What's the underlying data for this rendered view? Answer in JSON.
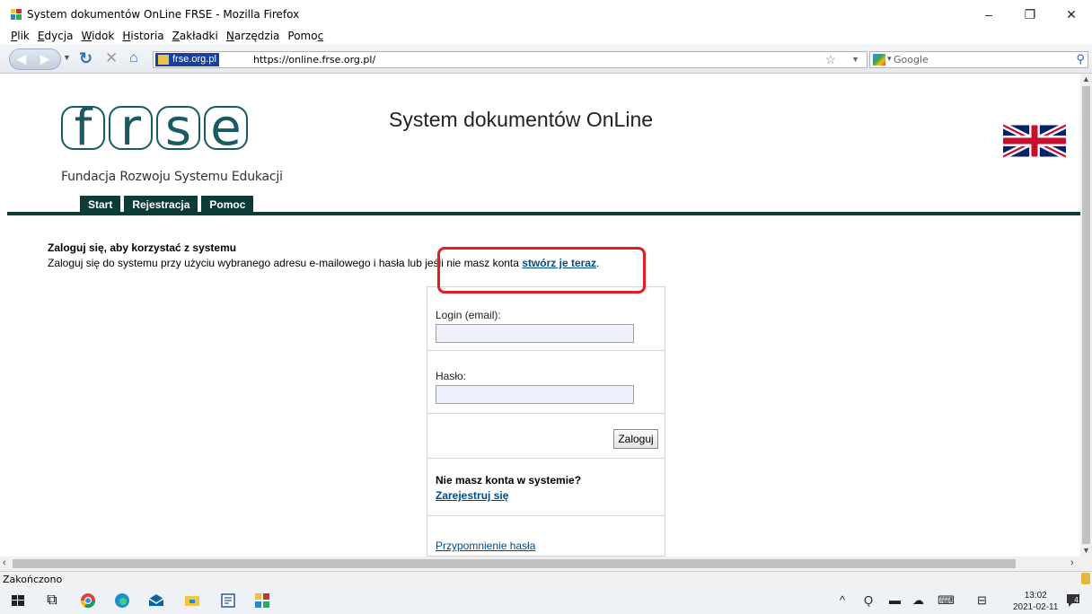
{
  "window": {
    "title": "System dokumentów OnLine FRSE - Mozilla Firefox",
    "minimize": "–",
    "restore": "❐",
    "close": "✕"
  },
  "menu": {
    "items": [
      {
        "ul": "P",
        "rest": "lik"
      },
      {
        "ul": "E",
        "rest": "dycja"
      },
      {
        "ul": "W",
        "rest": "idok"
      },
      {
        "ul": "H",
        "rest": "istoria"
      },
      {
        "ul": "Z",
        "rest": "akładki"
      },
      {
        "ul": "N",
        "rest": "arzędzia"
      },
      {
        "pre": "Pomo",
        "ul": "c"
      }
    ]
  },
  "toolbar": {
    "site_identity": "frse.org.pl",
    "url": "https://online.frse.org.pl/",
    "search_placeholder": "Google",
    "icons": {
      "back": "back-arrow-icon",
      "forward": "forward-arrow-icon",
      "reload": "reload-icon",
      "stop": "stop-icon",
      "home": "home-icon",
      "bookmark": "star-icon",
      "search": "magnifier-icon"
    }
  },
  "header": {
    "logo_letters": [
      "f",
      "r",
      "s",
      "e"
    ],
    "logo_subtitle": "Fundacja Rozwoju Systemu Edukacji",
    "site_title": "System dokumentów OnLine",
    "flag": "uk-flag-icon",
    "tabs": [
      "Start",
      "Rejestracja",
      "Pomoc"
    ],
    "brand_color": "#0d3b37"
  },
  "intro": {
    "title": "Zaloguj się, aby korzystać z systemu",
    "text_before": "Zaloguj się do systemu przy użyciu wybranego adresu e-mailowego i hasła lub jeśli nie masz konta ",
    "link": "stwórz je teraz",
    "text_after": "."
  },
  "login": {
    "email_label": "Login (email):",
    "email_value": "",
    "password_label": "Hasło:",
    "password_value": "",
    "submit": "Zaloguj",
    "no_account": "Nie masz konta w systemie?",
    "register_link": "Zarejestruj się",
    "remind_link": "Przypomnienie hasła"
  },
  "status": {
    "text": "Zakończono"
  },
  "taskbar": {
    "time": "13:02",
    "date": "2021-02-11",
    "notifications": "4"
  },
  "highlight_color": "#e21d1d"
}
